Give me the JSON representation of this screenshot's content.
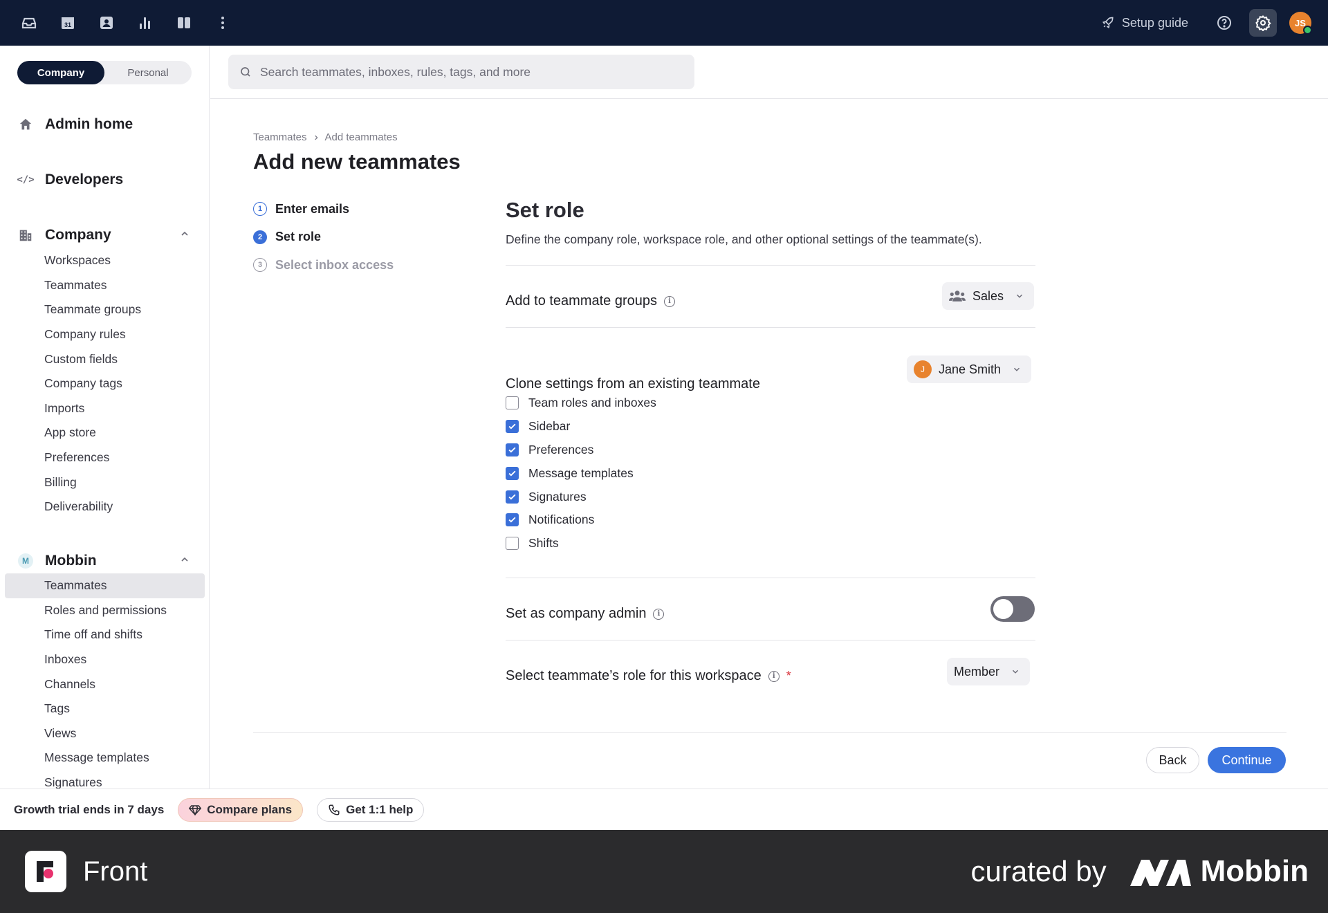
{
  "topbar": {
    "icons": [
      "inbox-icon",
      "calendar-icon",
      "contacts-icon",
      "analytics-icon",
      "split-view-icon",
      "more-icon"
    ],
    "calendar_day": "31",
    "setup_guide": "Setup guide",
    "avatar_initials": "JS",
    "status_color": "#3cc46a"
  },
  "sidebar": {
    "toggle": {
      "company": "Company",
      "personal": "Personal"
    },
    "admin_home": "Admin home",
    "developers": "Developers",
    "company": {
      "label": "Company",
      "items": [
        "Workspaces",
        "Teammates",
        "Teammate groups",
        "Company rules",
        "Custom fields",
        "Company tags",
        "Imports",
        "App store",
        "Preferences",
        "Billing",
        "Deliverability"
      ]
    },
    "workspace": {
      "badge": "M",
      "label": "Mobbin",
      "items": [
        "Teammates",
        "Roles and permissions",
        "Time off and shifts",
        "Inboxes",
        "Channels",
        "Tags",
        "Views",
        "Message templates",
        "Signatures"
      ],
      "active_index": 0
    }
  },
  "search": {
    "placeholder": "Search teammates, inboxes, rules, tags, and more"
  },
  "breadcrumb": {
    "parent": "Teammates",
    "current": "Add teammates"
  },
  "page_title": "Add new teammates",
  "steps": [
    {
      "num": "1",
      "label": "Enter emails",
      "state": "done"
    },
    {
      "num": "2",
      "label": "Set role",
      "state": "current"
    },
    {
      "num": "3",
      "label": "Select inbox access",
      "state": "pending"
    }
  ],
  "panel": {
    "title": "Set role",
    "description": "Define the company role, workspace role, and other optional settings of the teammate(s).",
    "groups": {
      "label": "Add to teammate groups",
      "value": "Sales"
    },
    "clone": {
      "label": "Clone settings from an existing teammate",
      "teammate": "Jane Smith",
      "teammate_initial": "J",
      "options": [
        {
          "label": "Team roles and inboxes",
          "checked": false
        },
        {
          "label": "Sidebar",
          "checked": true
        },
        {
          "label": "Preferences",
          "checked": true
        },
        {
          "label": "Message templates",
          "checked": true
        },
        {
          "label": "Signatures",
          "checked": true
        },
        {
          "label": "Notifications",
          "checked": true
        },
        {
          "label": "Shifts",
          "checked": false
        }
      ]
    },
    "admin": {
      "label": "Set as company admin",
      "enabled": false
    },
    "workspace_role": {
      "label": "Select teammate’s role for this workspace",
      "required_mark": "*",
      "value": "Member"
    }
  },
  "actions": {
    "back": "Back",
    "continue": "Continue"
  },
  "trial": {
    "text": "Growth trial ends in 7 days",
    "compare": "Compare plans",
    "help": "Get 1:1 help"
  },
  "brand": {
    "app": "Front",
    "curated_by": "curated by",
    "curator": "Mobbin"
  },
  "colors": {
    "topbar": "#0f1b35",
    "accent": "#3a74df",
    "avatar": "#e8832e"
  }
}
